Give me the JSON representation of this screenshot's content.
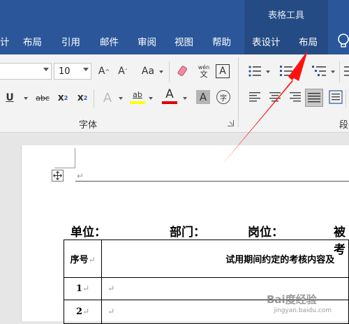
{
  "context_header": "表格工具",
  "tabs": [
    "计",
    "布局",
    "引用",
    "邮件",
    "审阅",
    "视图",
    "帮助",
    "表设计",
    "布局"
  ],
  "ribbon": {
    "font_size": "10",
    "grow_font": "A",
    "shrink_font": "A",
    "change_case": "Aa",
    "phonetic": "文",
    "char_border": "A",
    "underline": "U",
    "strikethrough": "abc",
    "subscript": "x",
    "subscript_digit": "2",
    "superscript": "x",
    "superscript_digit": "2",
    "text_effects": "A",
    "highlight_text": "ab",
    "font_color": "A",
    "char_shading": "A",
    "enclose_chars": "字",
    "font_group_label": "字体",
    "para_group_label": "段"
  },
  "document": {
    "fields": [
      "单位：",
      "部门：",
      "岗位：",
      "被考"
    ],
    "table_header": [
      "序号",
      "试用期间约定的考核内容及"
    ],
    "table_rows": [
      "1",
      "2"
    ],
    "para_mark": "↵"
  },
  "watermark": {
    "text": "Bai度经验",
    "url": "jingyan.baidu.com"
  },
  "colors": {
    "ribbon_blue": "#2b579a",
    "context_blue": "#254b84",
    "highlight_yellow": "#ffff00",
    "font_red": "#e00000",
    "arrow_red": "#ff1010"
  }
}
